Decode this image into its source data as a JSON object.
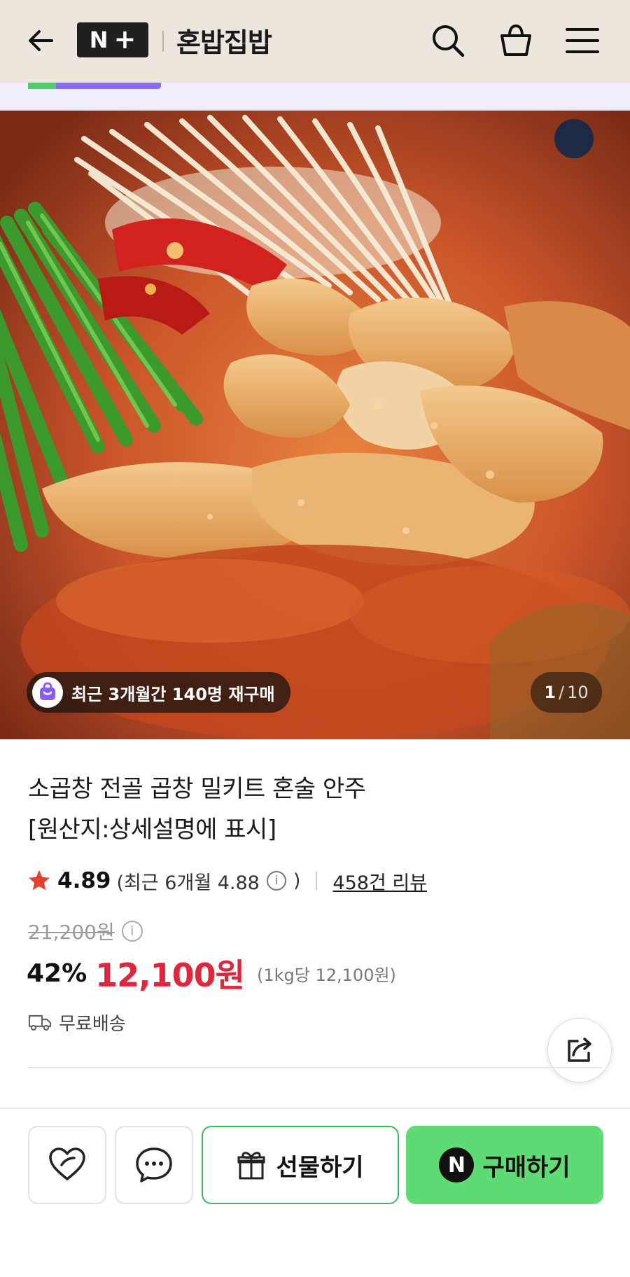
{
  "header": {
    "logo_text": "N",
    "logo_plus": "+",
    "store_name": "혼밥집밥",
    "icons": [
      "back-arrow-icon",
      "search-icon",
      "shopping-bag-icon",
      "hamburger-menu-icon"
    ]
  },
  "hero": {
    "repurchase_text": "최근 3개월간 140명 재구매",
    "page_current": "1",
    "page_separator": "/",
    "page_total": "10"
  },
  "product": {
    "title_line1": "소곱창 전골 곱창 밀키트 혼술 안주",
    "title_line2": "[원산지:상세설명에 표시]",
    "rating": "4.89",
    "rating_recent": "(최근 6개월 4.88",
    "rating_close": ")",
    "reviews": "458건 리뷰",
    "original_price": "21,200원",
    "discount": "42%",
    "sale_price": "12,100원",
    "unit_price": "(1kg당 12,100원)",
    "shipping": "무료배송"
  },
  "bottom_bar": {
    "gift_label": "선물하기",
    "buy_label": "구매하기",
    "buy_badge": "N"
  },
  "colors": {
    "header_bg": "#ece6df",
    "sale_red": "#e0263a",
    "buy_green": "#5fdb76",
    "gift_border": "#3fb860",
    "star": "#e5402b"
  }
}
